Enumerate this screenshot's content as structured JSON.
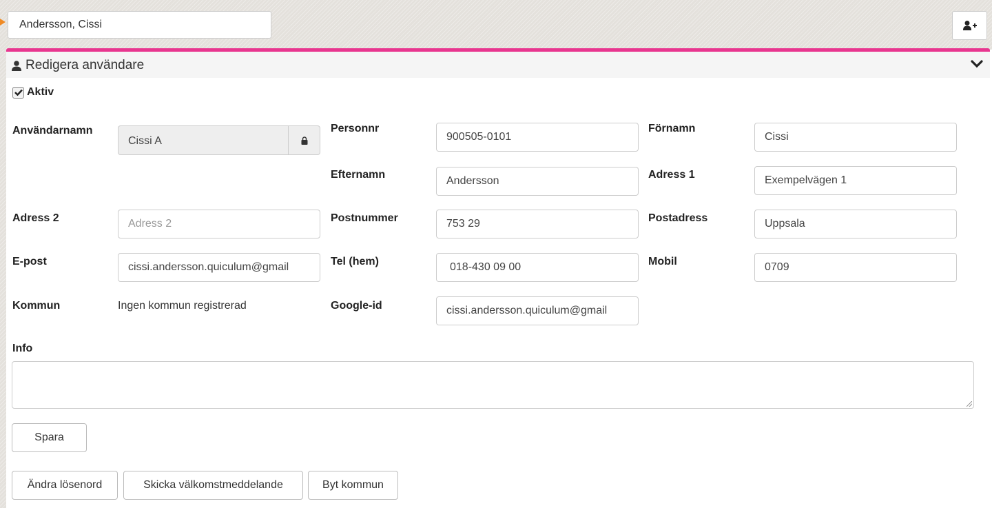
{
  "header": {
    "selected_user": "Andersson, Cissi",
    "add_user_icon": "user-plus-icon"
  },
  "panel": {
    "title": "Redigera användare",
    "user_icon": "user-icon",
    "collapse_icon": "chevron-down-icon",
    "accent_color": "#e8368f"
  },
  "form": {
    "aktiv": {
      "label": "Aktiv",
      "checked": true
    },
    "username": {
      "label": "Användarnamn",
      "value": "Cissi A",
      "lock_icon": "lock-icon"
    },
    "personnr": {
      "label": "Personnr",
      "value": "900505-0101"
    },
    "fornamn": {
      "label": "Förnamn",
      "value": "Cissi"
    },
    "efternamn": {
      "label": "Efternamn",
      "value": "Andersson"
    },
    "adress1": {
      "label": "Adress 1",
      "value": "Exempelvägen 1"
    },
    "adress2": {
      "label": "Adress 2",
      "value": "",
      "placeholder": "Adress 2"
    },
    "postnummer": {
      "label": "Postnummer",
      "value": "753 29"
    },
    "postadress": {
      "label": "Postadress",
      "value": "Uppsala"
    },
    "epost": {
      "label": "E-post",
      "value": "cissi.andersson.quiculum@gmail"
    },
    "telhem": {
      "label": "Tel (hem)",
      "value": "018-430 09 00"
    },
    "mobil": {
      "label": "Mobil",
      "value": "0709"
    },
    "kommun": {
      "label": "Kommun",
      "value": "Ingen kommun registrerad"
    },
    "googleid": {
      "label": "Google-id",
      "value": "cissi.andersson.quiculum@gmail"
    },
    "info": {
      "label": "Info",
      "value": ""
    }
  },
  "buttons": {
    "save": "Spara",
    "change_password": "Ändra lösenord",
    "send_welcome": "Skicka välkomstmeddelande",
    "change_municipality": "Byt kommun"
  }
}
